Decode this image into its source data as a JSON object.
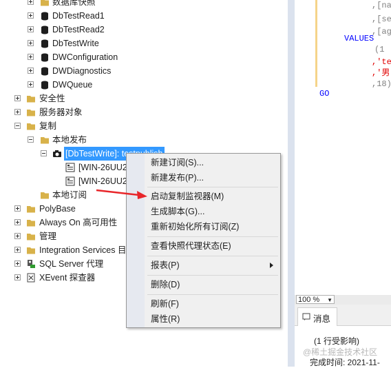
{
  "tree": {
    "db_partial": "数据库快照",
    "dbs": [
      "DbTestRead1",
      "DbTestRead2",
      "DbTestWrite",
      "DWConfiguration",
      "DWDiagnostics",
      "DWQueue"
    ],
    "security": "安全性",
    "server_objects": "服务器对象",
    "replication": "复制",
    "local_publications": "本地发布",
    "publication": "[DbTestWrite]: testpublish",
    "sub1": "[WIN-26UU2",
    "sub2": "[WIN-26UU2",
    "local_subscriptions": "本地订阅",
    "polybase": "PolyBase",
    "always_on": "Always On 高可用性",
    "management": "管理",
    "integration": "Integration Services 目录",
    "agent": "SQL Server 代理",
    "xevent": "XEvent 探查器"
  },
  "context_menu": {
    "items": [
      "新建订阅(S)...",
      "新建发布(P)...",
      "启动复制监视器(M)",
      "生成脚本(G)...",
      "重新初始化所有订阅(Z)",
      "查看快照代理状态(E)",
      "报表(P)",
      "删除(D)",
      "刷新(F)",
      "属性(R)"
    ]
  },
  "editor": {
    "l1": ",[na",
    "l2": ",[se",
    "l3": ",[ag",
    "values": "VALUES",
    "v1": "(1",
    "v2": ",'te",
    "v3": ",'男",
    "v4": ",18)",
    "go": "GO"
  },
  "zoom": {
    "value": "100 %"
  },
  "results": {
    "tab_label": "消息",
    "rows_affected": "(1 行受影响)",
    "completion": "完成时间: 2021-11-"
  },
  "watermark": "@稀土掘金技术社区",
  "colors": {
    "selection": "#3399ff",
    "arrow": "#e8262a",
    "folder": "#d8b24a",
    "keyword": "#0000ff",
    "string": "#e00000"
  }
}
